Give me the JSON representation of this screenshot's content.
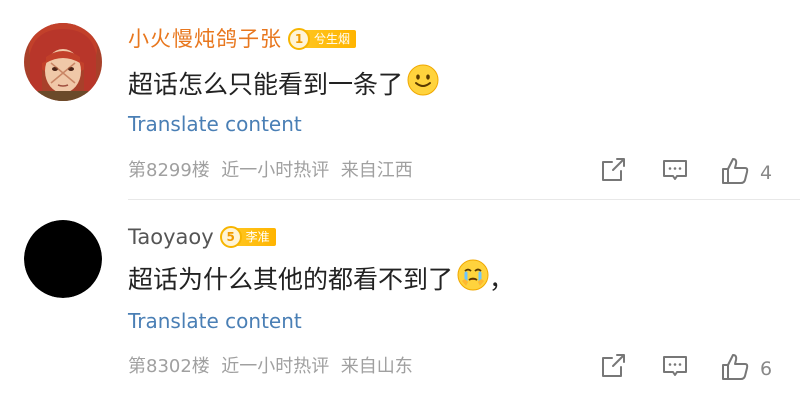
{
  "comments": [
    {
      "username": "小火慢炖鸽子张",
      "badge_level": "1",
      "badge_label": "兮生烟",
      "text": "超话怎么只能看到一条了",
      "emoji": "smile-emoji",
      "translate": "Translate content",
      "meta": "第8299楼  近一小时热评  来自江西",
      "likes": "4"
    },
    {
      "username": "Taoyaoy",
      "badge_level": "5",
      "badge_label": "李准",
      "text": "超话为什么其他的都看不到了",
      "emoji": "crying-emoji",
      "trailing": "，",
      "translate": "Translate content",
      "meta": "第8302楼  近一小时热评  来自山东",
      "likes": "6"
    }
  ],
  "icons": {
    "share": "share-icon",
    "reply": "comment-icon",
    "like": "thumbs-up-icon"
  },
  "colors": {
    "username_highlight": "#e8771e",
    "username": "#555555",
    "link": "#4a7fb5",
    "meta": "#a0a0a0",
    "badge": "#ffb400"
  }
}
